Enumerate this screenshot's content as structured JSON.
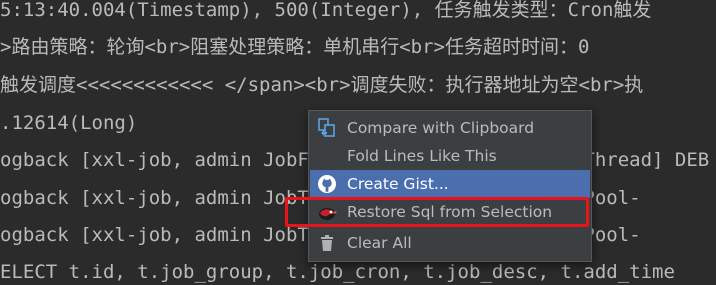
{
  "console": {
    "lines": [
      "5:13:40.004(Timestamp), 500(Integer), 任务触发类型：Cron触发",
      ">路由策略：轮询<br>阻塞处理策略：单机串行<br>任务超时时间：0",
      "触发调度<<<<<<<<<<<< </span><br>调度失败：执行器地址为空<br>执",
      ".12614(Long)",
      "ogback [xxl-job, admin JobFailMonitorHelper] INFO  Thread] DEB",
      "ogback [xxl-job, admin JobTriggerPoolHelper-triggerPool-",
      "ogback [xxl-job, admin JobTriggerPoolHelper-triggerPool-",
      "ELECT t.id, t.job_group, t.job_cron, t.job_desc, t.add_time"
    ]
  },
  "context_menu": {
    "items": [
      {
        "label": "Compare with Clipboard",
        "icon": "compare-clipboard-icon"
      },
      {
        "label": "Fold Lines Like This",
        "icon": ""
      },
      {
        "label": "Create Gist...",
        "icon": "github-icon"
      },
      {
        "label": "Restore Sql from Selection",
        "icon": "mybatis-bird-icon"
      },
      {
        "label": "Clear All",
        "icon": "trash-icon"
      }
    ],
    "selected_index": 2
  },
  "colors": {
    "console_bg": "#2b2b2b",
    "console_text": "#bababa",
    "menu_bg": "#3c3f41",
    "menu_selected": "#4b6eaf",
    "annotation_red": "#e8141b"
  }
}
